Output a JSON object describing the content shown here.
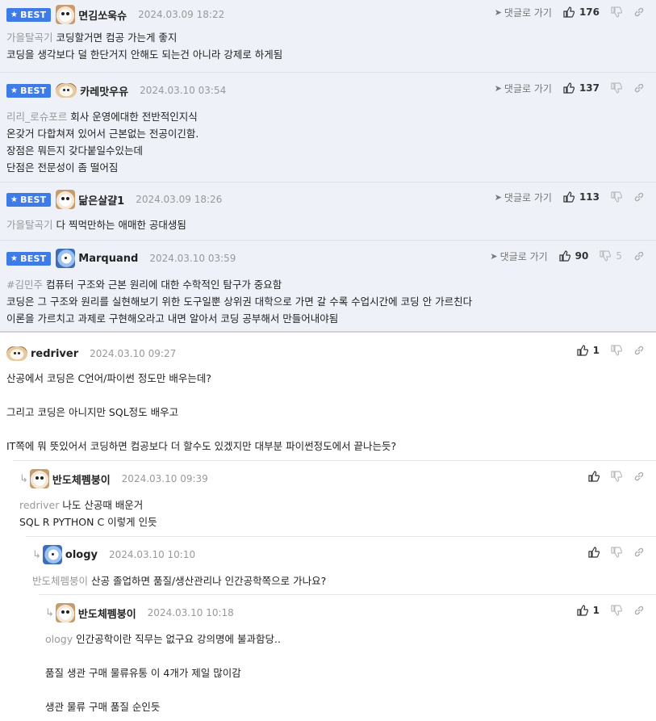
{
  "labels": {
    "best": "BEST",
    "goto": "댓글로 가기"
  },
  "colors": {
    "best_badge": "#3f7be6",
    "best_bg": "#eef1f8",
    "mention": "#999999"
  },
  "best_comments": [
    {
      "nick": "면김쏘욱슈",
      "date": "2024.03.09 18:22",
      "up": "176",
      "down": "",
      "mention": "가을탈곡기",
      "lines": [
        "코딩할거면 컴공 가는게 좋지",
        "코딩을 생각보다 덜 한단거지 안해도 되는건 아니라 강제로 하게됨"
      ]
    },
    {
      "nick": "카레맛우유",
      "date": "2024.03.10 03:54",
      "up": "137",
      "down": "",
      "mention": "리리_로슈포르",
      "lines": [
        "회사 운영에대한 전반적인지식",
        "온갖거 다합쳐져 있어서 근본없는 전공이긴함.",
        "장점은 뭐든지 갖다붙일수있는데",
        "단점은 전문성이 좀 떨어짐"
      ]
    },
    {
      "nick": "닮은살걀1",
      "date": "2024.03.09 18:26",
      "up": "113",
      "down": "",
      "mention": "가을탈곡기",
      "lines": [
        "다 찍먹만하는 애매한 공대생됨"
      ]
    },
    {
      "nick": "Marquand",
      "date": "2024.03.10 03:59",
      "up": "90",
      "down": "5",
      "mention": "#김민주",
      "lines": [
        "컴퓨터 구조와 근본 원리에 대한 수학적인 탐구가 중요함",
        "코딩은 그 구조와 원리를 실현해보기 위한 도구일뿐 상위권 대학으로 가면 갈 수록 수업시간에 코딩 안 가르친다",
        "이론을 가르치고 과제로 구현해오라고 내면 알아서 코딩 공부해서 만들어내야됨"
      ]
    }
  ],
  "comments": [
    {
      "nick": "redriver",
      "date": "2024.03.10 09:27",
      "up": "1",
      "mention": "",
      "lines": [
        "산공에서 코딩은 C언어/파이썬 정도만 배우는데?",
        "",
        "그리고 코딩은 아니지만 SQL정도 배우고",
        "",
        "IT쪽에 뭐 뜻있어서 코딩하면 컴공보다 더 할수도 있겠지만 대부분 파이썬정도에서 끝나는듯?"
      ]
    },
    {
      "nick": "반도체펨붕이",
      "date": "2024.03.10 09:39",
      "up": "",
      "mention": "redriver",
      "lines": [
        "나도 산공때 배운거",
        "SQL R PYTHON C 이렇게 인듯"
      ]
    },
    {
      "nick": "ology",
      "date": "2024.03.10 10:10",
      "up": "",
      "mention": "반도체펨붕이",
      "lines": [
        "산공 졸업하면 품질/생산관리나 인간공학쪽으로 가나요?"
      ]
    },
    {
      "nick": "반도체펨붕이",
      "date": "2024.03.10 10:18",
      "up": "1",
      "mention": "ology",
      "lines": [
        "인간공학이란 직무는 없구요 강의명에 불과함당..",
        "",
        "품질 생관 구매 물류유통 이 4개가 제일 많이감",
        "",
        "생관 물류 구매 품질 순인듯"
      ]
    }
  ]
}
